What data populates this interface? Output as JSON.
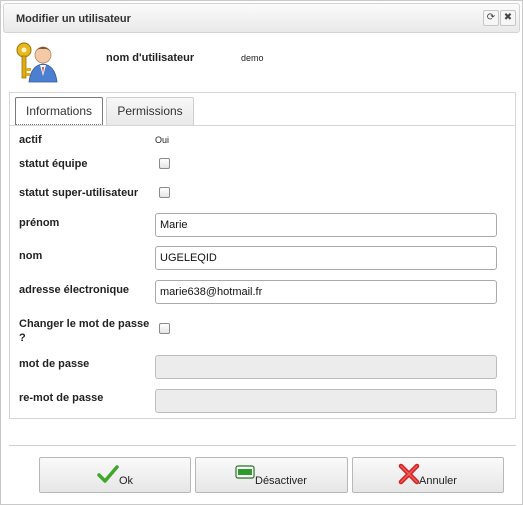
{
  "dialog": {
    "title": "Modifier un utilisateur",
    "restore_glyph": "⟳",
    "close_glyph": "✖"
  },
  "user": {
    "label": "nom d'utilisateur",
    "value": "demo",
    "icon": "user-keys-icon"
  },
  "tabs": [
    {
      "label": "Informations",
      "active": true
    },
    {
      "label": "Permissions",
      "active": false
    }
  ],
  "form": {
    "actif": {
      "label": "actif",
      "value": "Oui"
    },
    "statut_equipe": {
      "label": "statut équipe",
      "checked": false
    },
    "statut_super": {
      "label": "statut super-utilisateur",
      "checked": false
    },
    "prenom": {
      "label": "prénom",
      "value": "Marie"
    },
    "nom": {
      "label": "nom",
      "value": "UGELEQID"
    },
    "email": {
      "label": "adresse électronique",
      "value": "marie638@hotmail.fr"
    },
    "changer_mdp": {
      "label_line1": "Changer le mot de passe",
      "label_line2": "?",
      "checked": false
    },
    "mot_de_passe": {
      "label": "mot de passe",
      "value": ""
    },
    "re_mot_de_passe": {
      "label": "re-mot de passe",
      "value": ""
    }
  },
  "buttons": {
    "ok": {
      "label": "Ok",
      "icon": "checkmark-icon"
    },
    "deactivate": {
      "label": "Désactiver",
      "icon": "deactivate-icon"
    },
    "cancel": {
      "label": "Annuler",
      "icon": "cross-icon"
    }
  },
  "colors": {
    "ok_icon": "#3fa72a",
    "deactivate_icon": "#2a9d2a",
    "cancel_icon": "#d42020"
  }
}
